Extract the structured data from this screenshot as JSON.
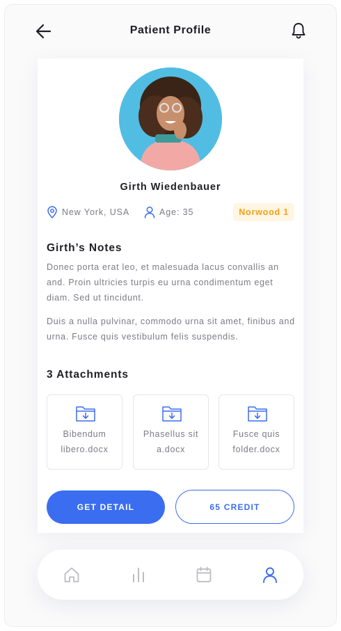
{
  "header": {
    "title": "Patient Profile",
    "back_icon": "arrow-left-icon",
    "notification_icon": "bell-icon"
  },
  "patient": {
    "name": "Girth Wiedenbauer",
    "location": "New York, USA",
    "age": "Age: 35",
    "badge": "Norwood 1"
  },
  "notes": {
    "title": "Girth’s Notes",
    "paragraphs": [
      "Donec porta erat leo, et malesuada lacus convallis an and. Proin ultricies turpis eu urna  condimentum  eget diam. Sed ut tincidunt.",
      "Duis a nulla pulvinar, commodo urna sit amet, finibus and urna. Fusce quis vestibulum felis suspendis."
    ]
  },
  "attachments": {
    "title": "3 Attachments",
    "files": [
      {
        "name": "Bibendum libero.docx"
      },
      {
        "name": "Phasellus sit a.docx"
      },
      {
        "name": "Fusce quis folder.docx"
      }
    ]
  },
  "actions": {
    "primary_label": "GET DETAIL",
    "secondary_label": "65 CREDIT"
  },
  "nav": {
    "items": [
      {
        "icon": "home-icon",
        "active": false
      },
      {
        "icon": "bar-chart-icon",
        "active": false
      },
      {
        "icon": "calendar-icon",
        "active": false
      },
      {
        "icon": "user-icon",
        "active": true
      }
    ]
  },
  "colors": {
    "accent": "#3b6df0",
    "badge_bg": "#fff5e3",
    "badge_text": "#f0a31a",
    "muted_text": "#7b7b84",
    "inactive_icon": "#b9b9c0"
  }
}
